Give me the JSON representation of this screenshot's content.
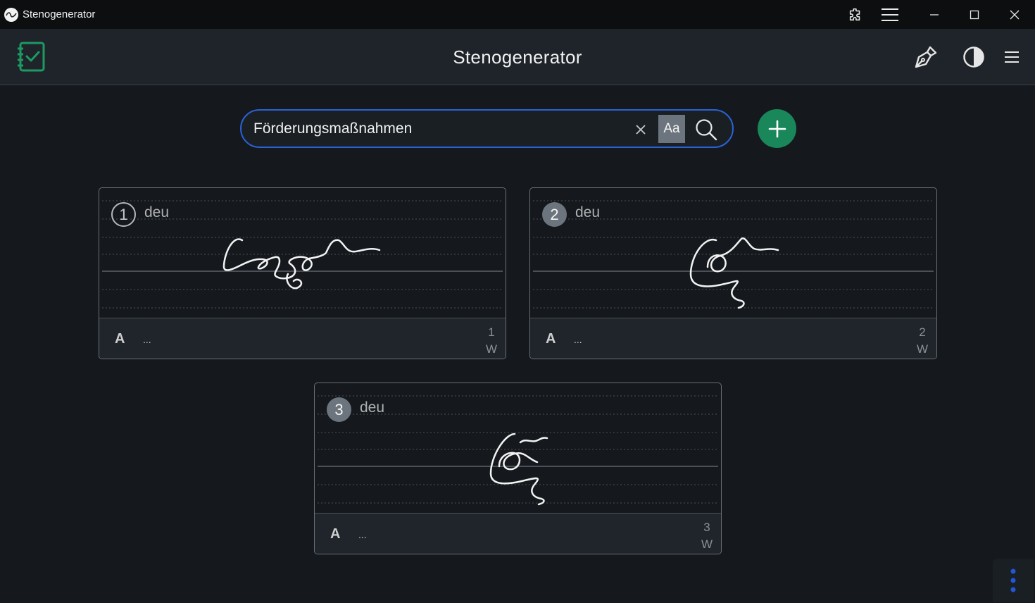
{
  "window": {
    "title": "Stenogenerator",
    "icons": [
      "app-logo-icon",
      "extension-icon",
      "menu-lines-icon",
      "minimize-icon",
      "maximize-icon",
      "close-icon"
    ]
  },
  "header": {
    "title": "Stenogenerator",
    "icons": [
      "notebook-check-icon",
      "pen-nib-icon",
      "contrast-icon",
      "hamburger-icon"
    ]
  },
  "search": {
    "value": "Förderungsmaßnahmen",
    "case_label": "Aa",
    "icons": [
      "clear-icon",
      "search-icon",
      "plus-icon"
    ]
  },
  "cards": [
    {
      "number": "1",
      "language": "deu",
      "font_label": "A",
      "more": "...",
      "count": "1",
      "unit": "W"
    },
    {
      "number": "2",
      "language": "deu",
      "font_label": "A",
      "more": "...",
      "count": "2",
      "unit": "W"
    },
    {
      "number": "3",
      "language": "deu",
      "font_label": "A",
      "more": "...",
      "count": "3",
      "unit": "W"
    }
  ],
  "colors": {
    "background": "#15191e",
    "header": "#1e2429",
    "accent_blue": "#2a62d6",
    "add_green": "#19875a",
    "badge_gray": "#6c757d",
    "fab_dots": "#1f57d6"
  }
}
